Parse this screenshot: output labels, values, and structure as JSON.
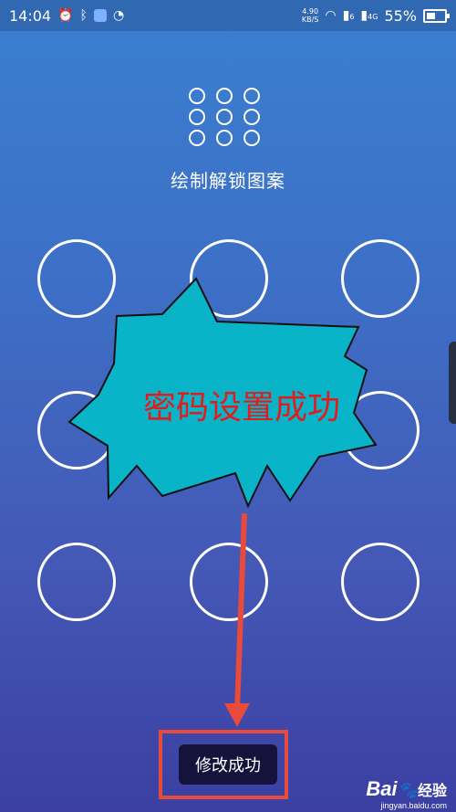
{
  "status_bar": {
    "time": "14:04",
    "network_speed": "4.90",
    "network_speed_unit": "KB/S",
    "signal_1_label": "6",
    "signal_2_label": "4G",
    "battery_percent": "55%"
  },
  "lock_screen": {
    "title": "绘制解锁图案"
  },
  "annotation": {
    "callout_text": "密码设置成功"
  },
  "button": {
    "modify_label": "修改成功"
  },
  "watermark": {
    "brand": "Bai",
    "brand_suffix": "经验",
    "url": "jingyan.baidu.com"
  },
  "colors": {
    "burst_fill": "#0ab4c8",
    "callout_text": "#e21c1c",
    "arrow": "#e84b3c"
  }
}
